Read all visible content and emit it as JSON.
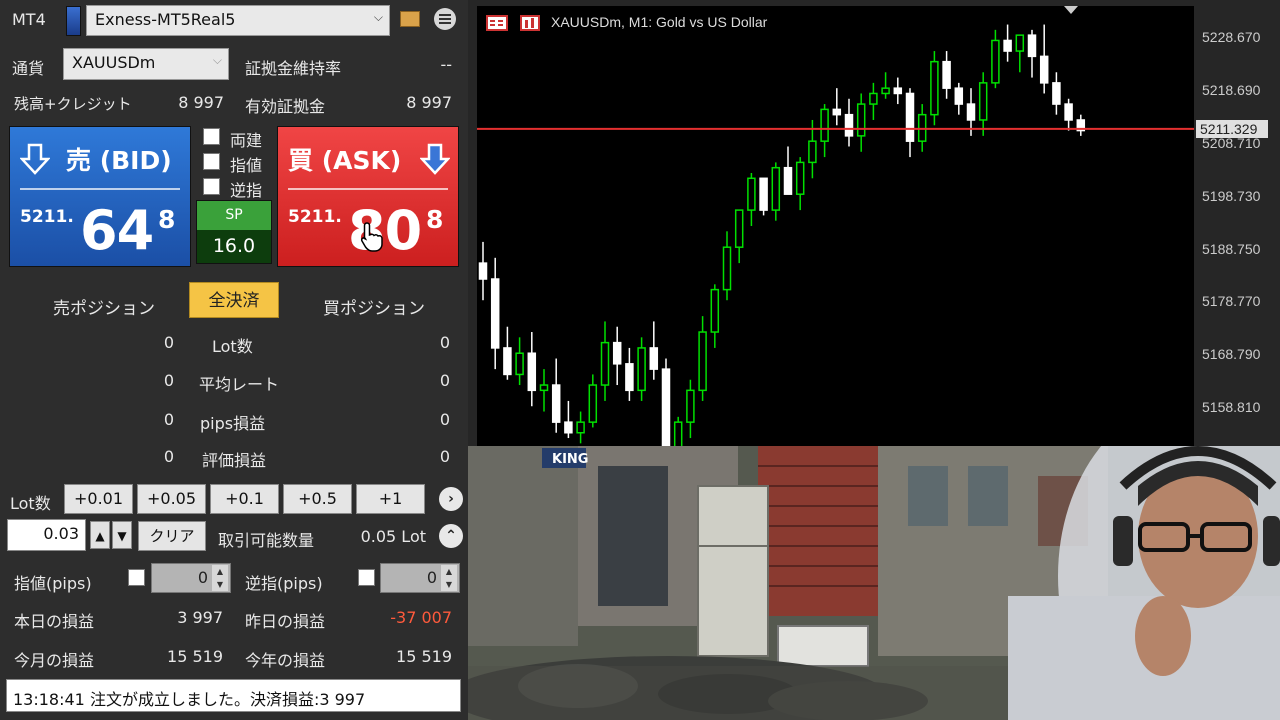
{
  "panel": {
    "app_label": "MT4",
    "account": "Exness-MT5Real5",
    "currency_label": "通貨",
    "symbol": "XAUUSDm",
    "margin_level_label": "証拠金維持率",
    "margin_level_value": "--",
    "balance_label": "残高+クレジット",
    "balance_value": "8 997",
    "equity_label": "有効証拠金",
    "equity_value": "8 997",
    "sell": {
      "label": "売 (BID)",
      "price_prefix": "5211.",
      "price_big": "64",
      "price_sup": "8"
    },
    "buy": {
      "label": "買 (ASK)",
      "price_prefix": "5211.",
      "price_big": "80",
      "price_sup": "8"
    },
    "options": [
      {
        "label": "両建"
      },
      {
        "label": "指値"
      },
      {
        "label": "逆指"
      }
    ],
    "spread": {
      "label": "SP",
      "value": "16.0"
    },
    "sell_positions_label": "売ポジション",
    "close_all_label": "全決済",
    "buy_positions_label": "買ポジション",
    "stats": [
      {
        "label": "Lot数",
        "sell": "0",
        "buy": "0"
      },
      {
        "label": "平均レート",
        "sell": "0",
        "buy": "0"
      },
      {
        "label": "pips損益",
        "sell": "0",
        "buy": "0"
      },
      {
        "label": "評価損益",
        "sell": "0",
        "buy": "0"
      }
    ],
    "lot_label": "Lot数",
    "lot_buttons": [
      "+0.01",
      "+0.05",
      "+0.1",
      "+0.5",
      "+1"
    ],
    "lot_value": "0.03",
    "clear_label": "クリア",
    "tradable_label": "取引可能数量",
    "tradable_value": "0.05 Lot",
    "limit_label": "指値(pips)",
    "limit_value": "0",
    "stop_label": "逆指(pips)",
    "stop_value": "0",
    "today_pl_label": "本日の損益",
    "today_pl_value": "3 997",
    "yesterday_pl_label": "昨日の損益",
    "yesterday_pl_value": "-37 007",
    "month_pl_label": "今月の損益",
    "month_pl_value": "15 519",
    "year_pl_label": "今年の損益",
    "year_pl_value": "15 519",
    "status_message": "13:18:41 注文が成立しました。決済損益:3 997"
  },
  "chart": {
    "title": "XAUUSDm, M1:  Gold vs US Dollar",
    "current_price_label": "5211.329",
    "colors": {
      "up": "#00e000",
      "down": "#ffffff",
      "current_line": "#e53030"
    }
  },
  "chart_data": {
    "type": "candlestick",
    "symbol": "XAUUSDm",
    "timeframe": "M1",
    "y_tick_labels": [
      "5228.670",
      "5218.690",
      "5208.710",
      "5198.730",
      "5188.750",
      "5178.770",
      "5168.790",
      "5158.810"
    ],
    "ylim": [
      5151.5,
      5234.5
    ],
    "current_price": 5211.329,
    "candles": [
      [
        5186,
        5190,
        5179,
        5183
      ],
      [
        5183,
        5187,
        5166,
        5170
      ],
      [
        5170,
        5174,
        5164,
        5165
      ],
      [
        5165,
        5172,
        5163,
        5169
      ],
      [
        5169,
        5173,
        5159,
        5162
      ],
      [
        5162,
        5166,
        5158,
        5163
      ],
      [
        5163,
        5168,
        5154,
        5156
      ],
      [
        5156,
        5160,
        5153,
        5154
      ],
      [
        5154,
        5158,
        5152,
        5156
      ],
      [
        5156,
        5165,
        5155,
        5163
      ],
      [
        5163,
        5175,
        5160,
        5171
      ],
      [
        5171,
        5174,
        5163,
        5167
      ],
      [
        5167,
        5170,
        5160,
        5162
      ],
      [
        5162,
        5172,
        5160,
        5170
      ],
      [
        5170,
        5175,
        5164,
        5166
      ],
      [
        5166,
        5168,
        5149,
        5151
      ],
      [
        5151,
        5157,
        5150,
        5156
      ],
      [
        5156,
        5164,
        5153,
        5162
      ],
      [
        5162,
        5176,
        5160,
        5173
      ],
      [
        5173,
        5182,
        5170,
        5181
      ],
      [
        5181,
        5192,
        5179,
        5189
      ],
      [
        5189,
        5196,
        5186,
        5196
      ],
      [
        5196,
        5203,
        5193,
        5202
      ],
      [
        5202,
        5202,
        5195,
        5196
      ],
      [
        5196,
        5205,
        5194,
        5204
      ],
      [
        5204,
        5208,
        5199,
        5199
      ],
      [
        5199,
        5206,
        5196,
        5205
      ],
      [
        5205,
        5213,
        5202,
        5209
      ],
      [
        5209,
        5216,
        5206,
        5215
      ],
      [
        5215,
        5219,
        5212,
        5214
      ],
      [
        5214,
        5217,
        5208,
        5210
      ],
      [
        5210,
        5218,
        5207,
        5216
      ],
      [
        5216,
        5220,
        5213,
        5218
      ],
      [
        5218,
        5222,
        5217,
        5219
      ],
      [
        5219,
        5221,
        5216,
        5218
      ],
      [
        5218,
        5219,
        5206,
        5209
      ],
      [
        5209,
        5216,
        5207,
        5214
      ],
      [
        5214,
        5226,
        5212,
        5224
      ],
      [
        5224,
        5226,
        5217,
        5219
      ],
      [
        5219,
        5220,
        5214,
        5216
      ],
      [
        5216,
        5219,
        5210,
        5213
      ],
      [
        5213,
        5222,
        5210,
        5220
      ],
      [
        5220,
        5230,
        5219,
        5228
      ],
      [
        5228,
        5231,
        5224,
        5226
      ],
      [
        5226,
        5229,
        5222,
        5229
      ],
      [
        5229,
        5230,
        5221,
        5225
      ],
      [
        5225,
        5231,
        5218,
        5220
      ],
      [
        5220,
        5222,
        5214,
        5216
      ],
      [
        5216,
        5217,
        5211,
        5213
      ],
      [
        5213,
        5214,
        5210,
        5211
      ]
    ]
  },
  "scene": {
    "sign_text": "KING"
  }
}
